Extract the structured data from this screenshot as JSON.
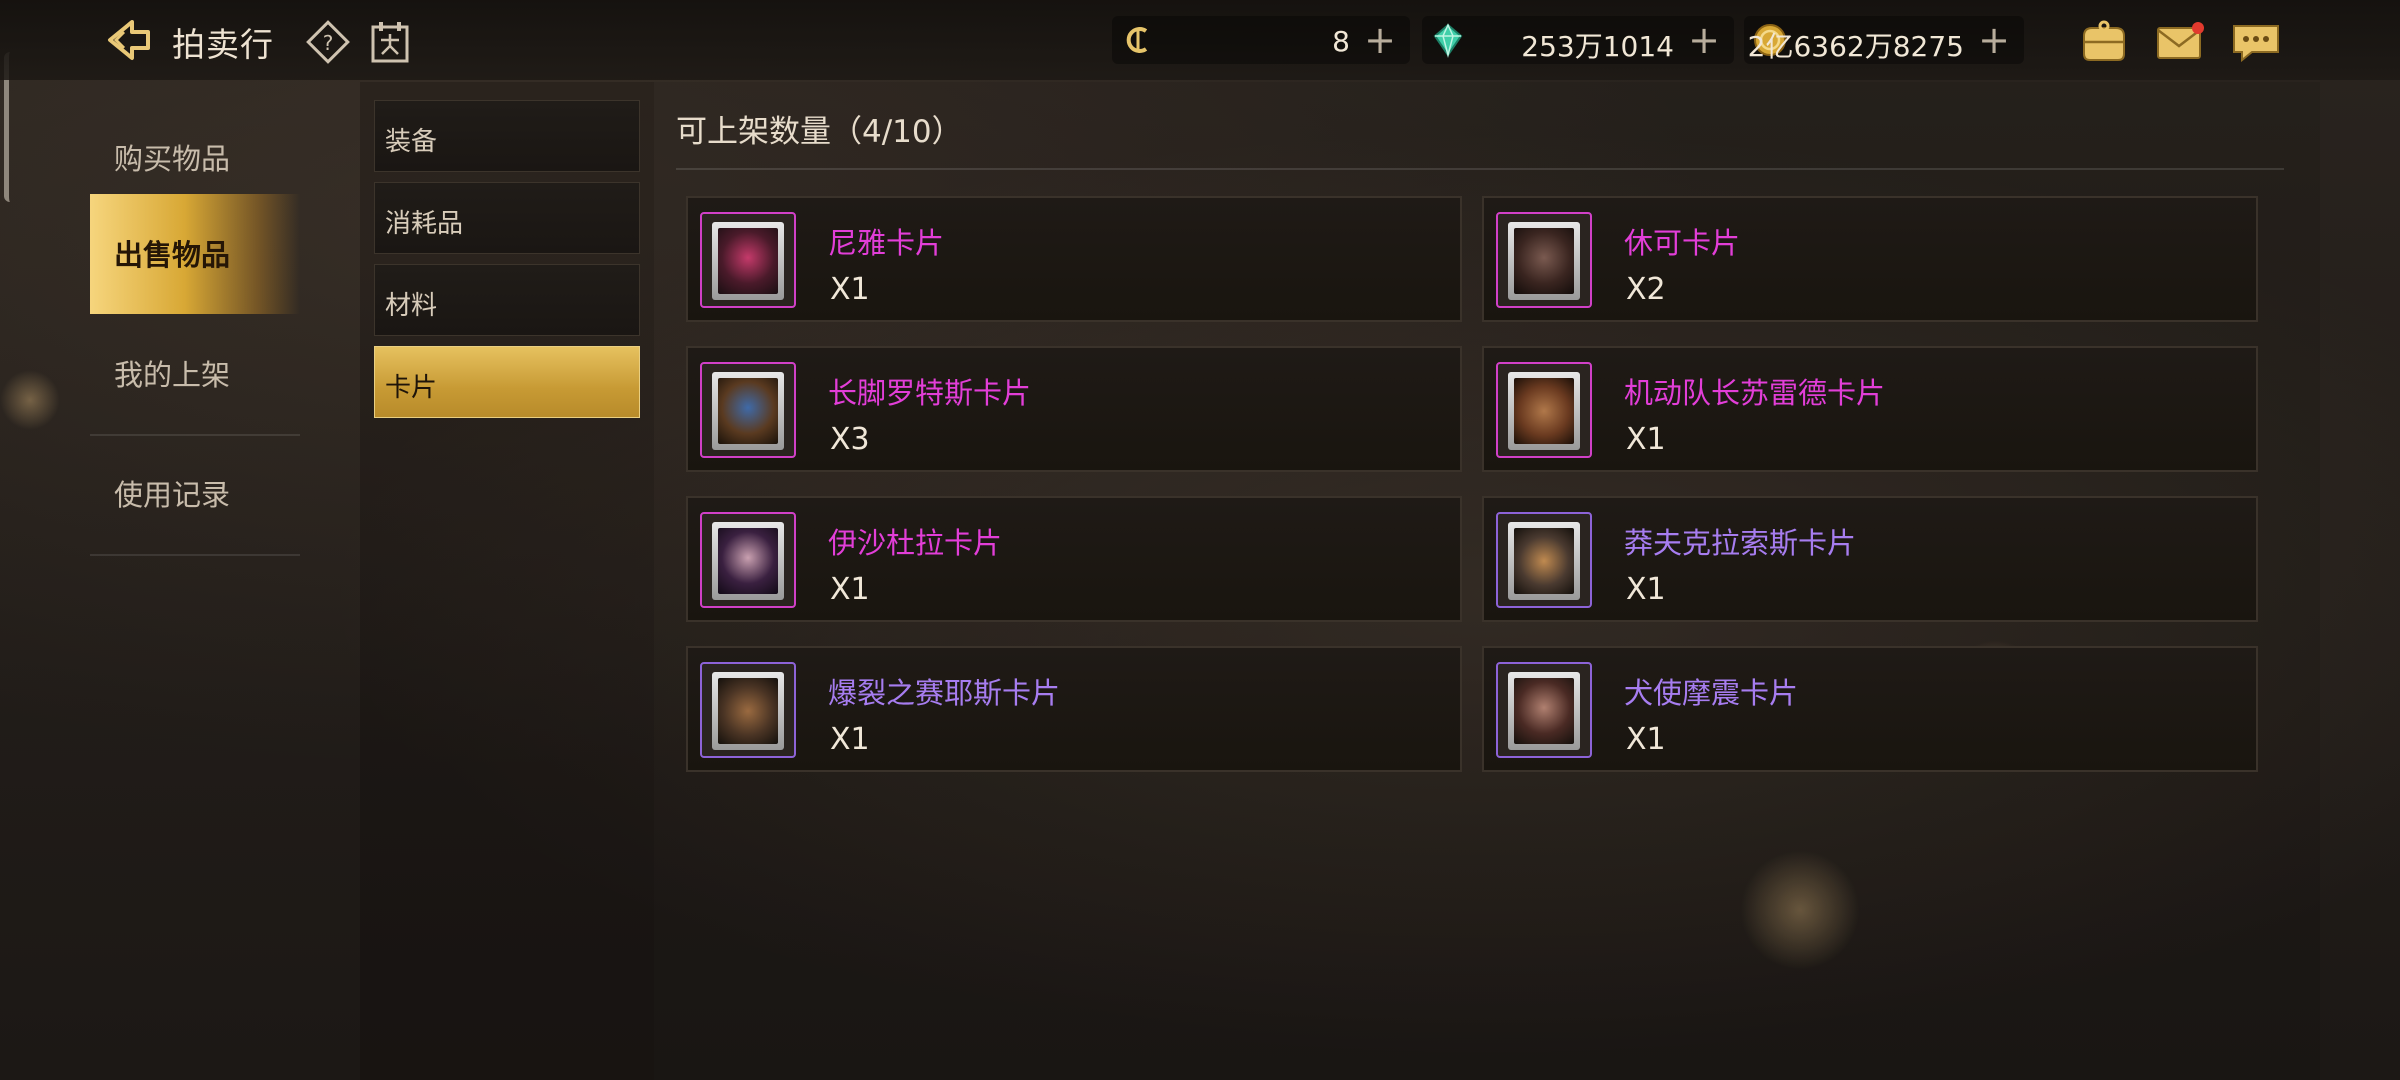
{
  "header": {
    "title": "拍卖行"
  },
  "resources": [
    {
      "name": "coupon",
      "icon": "coupon-icon",
      "value": "8",
      "plus": "+"
    },
    {
      "name": "diamond",
      "icon": "diamond-icon",
      "value": "253万1014",
      "plus": "+"
    },
    {
      "name": "gold",
      "icon": "gold-coin-icon",
      "value": "2亿6362万8275",
      "plus": "+"
    }
  ],
  "left_menu": {
    "items": [
      {
        "label": "购买物品",
        "active": false
      },
      {
        "label": "出售物品",
        "active": true
      },
      {
        "label": "我的上架",
        "active": false
      },
      {
        "label": "使用记录",
        "active": false
      }
    ]
  },
  "categories": {
    "items": [
      {
        "label": "装备",
        "active": false
      },
      {
        "label": "消耗品",
        "active": false
      },
      {
        "label": "材料",
        "active": false
      },
      {
        "label": "卡片",
        "active": true
      }
    ]
  },
  "listing": {
    "title": "可上架数量（4/10）"
  },
  "cards": [
    {
      "name": "尼雅卡片",
      "qty": "X1",
      "rarity_color": "#e23ed8"
    },
    {
      "name": "休可卡片",
      "qty": "X2",
      "rarity_color": "#e23ed8"
    },
    {
      "name": "长脚罗特斯卡片",
      "qty": "X3",
      "rarity_color": "#e23ed8"
    },
    {
      "name": "机动队长苏雷德卡片",
      "qty": "X1",
      "rarity_color": "#e23ed8"
    },
    {
      "name": "伊沙杜拉卡片",
      "qty": "X1",
      "rarity_color": "#e23ed8"
    },
    {
      "name": "莽夫克拉索斯卡片",
      "qty": "X1",
      "rarity_color": "#a77df0"
    },
    {
      "name": "爆裂之赛耶斯卡片",
      "qty": "X1",
      "rarity_color": "#a77df0"
    },
    {
      "name": "犬使摩震卡片",
      "qty": "X1",
      "rarity_color": "#a77df0"
    }
  ],
  "colors": {
    "accent_gold": "#d8a835",
    "rare_magenta": "#e23ed8",
    "rare_purple": "#a77df0"
  }
}
